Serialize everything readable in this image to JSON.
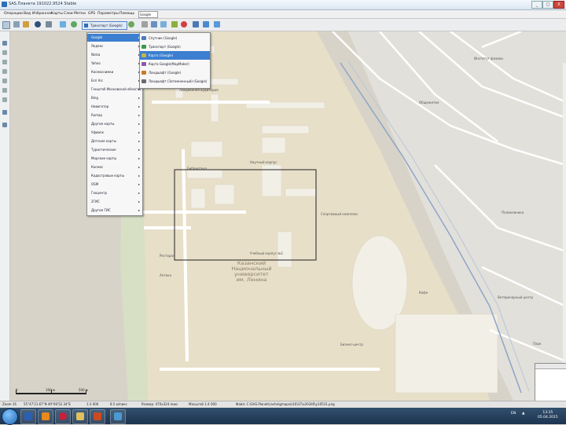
{
  "window": {
    "title": "SAS.Планета 191022.9524 Stable",
    "controls": [
      "_",
      "□",
      "X"
    ]
  },
  "menubar": {
    "items": [
      "Операции",
      "Вид",
      "Избранное",
      "Карты",
      "Слои",
      "Метки",
      "GPS",
      "Параметры",
      "Помощь",
      "Google"
    ],
    "google_select": "Google"
  },
  "toolbar": {
    "map_type": "Транспорт (Google)"
  },
  "dropdown": {
    "items": [
      {
        "label": "Google",
        "arrow": "▸"
      },
      {
        "label": "Яндекс",
        "arrow": "▸"
      },
      {
        "label": "Nokia",
        "arrow": "▸"
      },
      {
        "label": "Yahoo",
        "arrow": "▸"
      },
      {
        "label": "Космоснимки",
        "arrow": "▸"
      },
      {
        "label": "Esri Arc",
        "arrow": "▸"
      },
      {
        "label": "Генштаб Московской области",
        "arrow": "▸"
      },
      {
        "label": "Bing",
        "arrow": "▸"
      },
      {
        "label": "Навигатор",
        "arrow": "▸"
      },
      {
        "label": "Rumap",
        "arrow": "▸"
      },
      {
        "label": "Другие карты",
        "arrow": "▸"
      },
      {
        "label": "Уфимск",
        "arrow": "▸"
      },
      {
        "label": "Детские карты",
        "arrow": "▸"
      },
      {
        "label": "Туристические",
        "arrow": "▸"
      },
      {
        "label": "Морские карты",
        "arrow": "▸"
      },
      {
        "label": "Космос",
        "arrow": "▸"
      },
      {
        "label": "Кадастровые карты",
        "arrow": "▸"
      },
      {
        "label": "OSM",
        "arrow": "▸"
      },
      {
        "label": "Геоцентр",
        "arrow": "▸"
      },
      {
        "label": "2ГИС",
        "arrow": "▸"
      },
      {
        "label": "Другие ГИС",
        "arrow": "▸"
      }
    ],
    "selected_index": 0
  },
  "submenu": {
    "items": [
      {
        "label": "Спутник (Google)",
        "icon_color": "#4a7db8"
      },
      {
        "label": "Транспорт (Google)",
        "icon_color": "#3c9a4a"
      },
      {
        "label": "Карта (Google)",
        "icon_color": "#c8b44a"
      },
      {
        "label": "Карта Google(MapMaker)",
        "icon_color": "#8a5aa8"
      },
      {
        "label": "Ландшафт (Google)",
        "icon_color": "#c87a2a"
      },
      {
        "label": "Ландшафт (Затемненный) (Google)",
        "icon_color": "#6a6a6a"
      }
    ],
    "selected_index": 2
  },
  "map": {
    "labels": [
      {
        "text": "Лекционная аудитория",
        "bold": false
      },
      {
        "text": "Библиотека",
        "bold": false
      },
      {
        "text": "Научный корпус",
        "bold": false
      },
      {
        "text": "Спортивный комплекс",
        "bold": false
      },
      {
        "text": "Общежитие",
        "bold": false
      },
      {
        "text": "Ресторан",
        "bold": false
      },
      {
        "text": "Учебный корпус №2",
        "bold": false
      },
      {
        "text": "Бизнес-центр",
        "bold": false
      },
      {
        "text": "Аптека",
        "bold": false
      },
      {
        "text": "Кафе",
        "bold": false
      },
      {
        "text": "Казанский\nНациональный\nуниверситет\nим. Ленина",
        "bold": true
      },
      {
        "text": "Институт физики",
        "bold": false
      },
      {
        "text": "Поликлиника",
        "bold": false
      },
      {
        "text": "Ветеринарный центр",
        "bold": false
      },
      {
        "text": "Парк",
        "bold": false
      }
    ],
    "scale_labels": [
      "0",
      "100 м",
      "500 м"
    ]
  },
  "statusbar": {
    "items": [
      "Zoom 16",
      "55°47'21.67\"N 49°06'52.34\"E",
      "1:3 000",
      "8.5 м/пикс",
      "Размер: 470x324 пикс",
      "Масштаб 1:4 000",
      "Файл: C:\\SAS.Planet\\cache\\gmaps\\z16\\37\\x20340\\y10531.png"
    ]
  },
  "taskbar": {
    "apps": [
      {
        "name": "word",
        "color": "#2b5fb3"
      },
      {
        "name": "vlc",
        "color": "#e88a1a"
      },
      {
        "name": "opera",
        "color": "#c8203a"
      },
      {
        "name": "explorer",
        "color": "#e0c060"
      },
      {
        "name": "powerpoint",
        "color": "#cc4a20"
      },
      {
        "name": "sas-planet",
        "color": "#4a9ad0"
      }
    ],
    "tray_lang": "EN",
    "clock_time": "13:35",
    "clock_date": "05.04.2015"
  }
}
